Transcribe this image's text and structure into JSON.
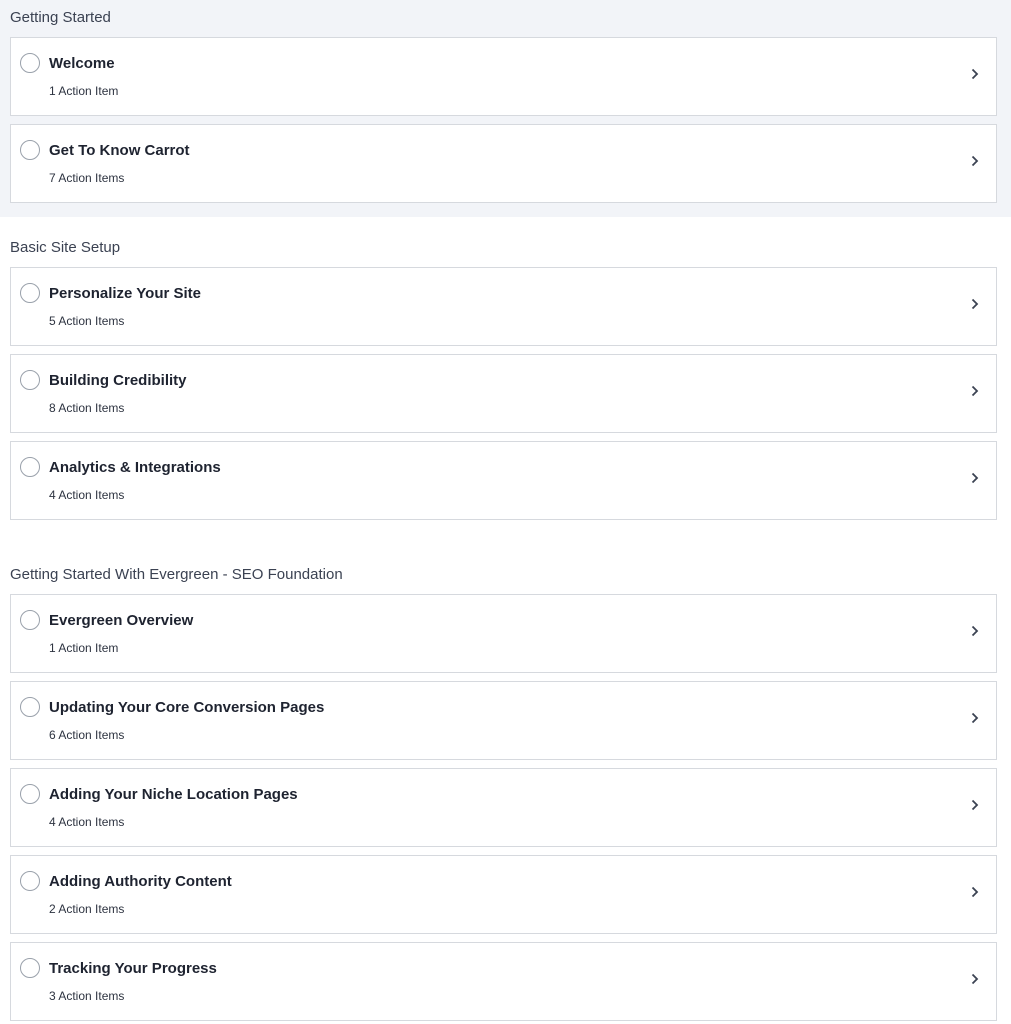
{
  "sections": [
    {
      "title": "Getting Started",
      "items": [
        {
          "title": "Welcome",
          "subtitle": "1 Action Item"
        },
        {
          "title": "Get To Know Carrot",
          "subtitle": "7 Action Items"
        }
      ]
    },
    {
      "title": "Basic Site Setup",
      "items": [
        {
          "title": "Personalize Your Site",
          "subtitle": "5 Action Items"
        },
        {
          "title": "Building Credibility",
          "subtitle": "8 Action Items"
        },
        {
          "title": "Analytics & Integrations",
          "subtitle": "4 Action Items"
        }
      ]
    },
    {
      "title": "Getting Started With Evergreen - SEO Foundation",
      "items": [
        {
          "title": "Evergreen Overview",
          "subtitle": "1 Action Item"
        },
        {
          "title": "Updating Your Core Conversion Pages",
          "subtitle": "6 Action Items"
        },
        {
          "title": "Adding Your Niche Location Pages",
          "subtitle": "4 Action Items"
        },
        {
          "title": "Adding Authority Content",
          "subtitle": "2 Action Items"
        },
        {
          "title": "Tracking Your Progress",
          "subtitle": "3 Action Items"
        }
      ]
    }
  ],
  "icons": {
    "status": "empty-circle-icon",
    "open": "chevron-right-icon"
  },
  "colors": {
    "section_bg": "#f2f4f8",
    "card_border": "#d6d9de",
    "text": "#1e2330"
  }
}
